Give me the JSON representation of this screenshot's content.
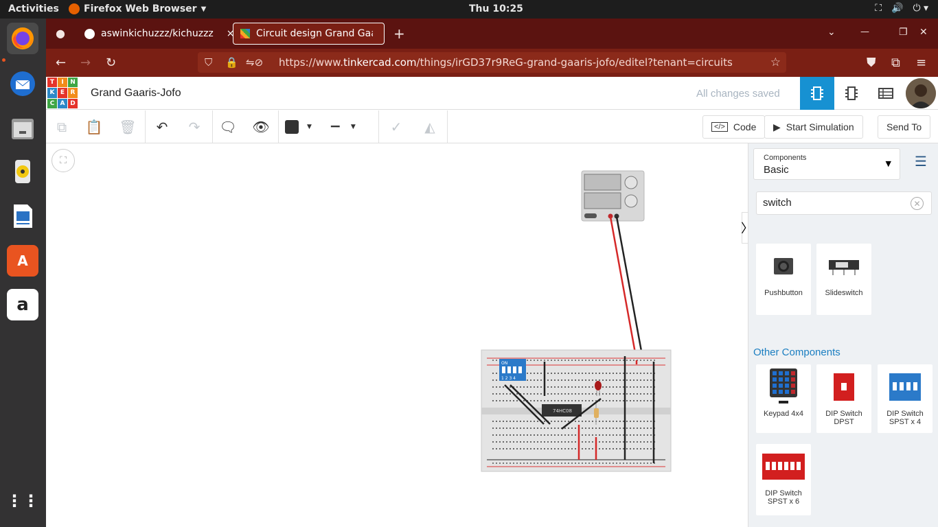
{
  "topbar": {
    "activities": "Activities",
    "app_name": "Firefox Web Browser",
    "clock": "Thu 10:25",
    "tray_icons": [
      "network-icon",
      "volume-icon",
      "power-icon"
    ]
  },
  "dock": {
    "apps": [
      "firefox",
      "thunderbird",
      "files",
      "rhythmbox",
      "writer",
      "software",
      "amazon"
    ],
    "show_apps": "show-apps-icon"
  },
  "browser": {
    "tabs": [
      {
        "label": "aswinkichuzzz/kichuzzz",
        "close": "×"
      },
      {
        "label": "Circuit design Grand Gaar",
        "close": "×"
      }
    ],
    "new_tab": "+",
    "window": {
      "min": "—",
      "max": "❐",
      "close": "✕"
    },
    "url_prefix": "https://www.",
    "url_host": "tinkercad.com",
    "url_path": "/things/irGD37r9ReG-grand-gaaris-jofo/editel?tenant=circuits"
  },
  "tinkercad": {
    "logo_letters": [
      "T",
      "I",
      "N",
      "K",
      "E",
      "R",
      "C",
      "A",
      "D"
    ],
    "project_title": "Grand Gaaris-Jofo",
    "saved_status": "All changes saved",
    "toolbar": {
      "code": "Code",
      "start_simulation": "Start Simulation",
      "send_to": "Send To"
    },
    "panel": {
      "components_label": "Components",
      "components_value": "Basic",
      "search_value": "switch",
      "basic_results": [
        {
          "name": "Pushbutton"
        },
        {
          "name": "Slideswitch"
        }
      ],
      "other_header": "Other Components",
      "other_results": [
        {
          "name": "Keypad 4x4"
        },
        {
          "name": "DIP Switch DPST"
        },
        {
          "name": "DIP Switch SPST x 4"
        },
        {
          "name": "DIP Switch SPST x 6"
        }
      ]
    },
    "circuit": {
      "chip_label": "74HC08",
      "dip_label": "ON",
      "dip_numbers": "1 2 3 4"
    }
  },
  "colors": {
    "tab_bg": "#5b1310",
    "nav_bg": "#7a1f14",
    "accent": "#1791d2",
    "link": "#1a7ec1"
  }
}
